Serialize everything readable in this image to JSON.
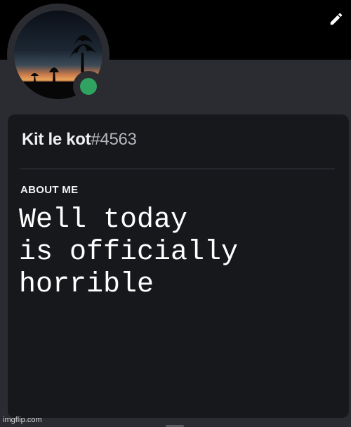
{
  "banner": {
    "color": "#000000"
  },
  "edit_button": {
    "icon": "pencil-icon"
  },
  "avatar": {
    "description_icon": "avatar",
    "status": "online",
    "status_color": "#2fa35f"
  },
  "profile": {
    "display_name": "Kit le kot",
    "discriminator": "#4563",
    "about_label": "ABOUT ME",
    "about_text": "Well today\nis officially\nhorrible"
  },
  "watermark": "imgflip.com"
}
